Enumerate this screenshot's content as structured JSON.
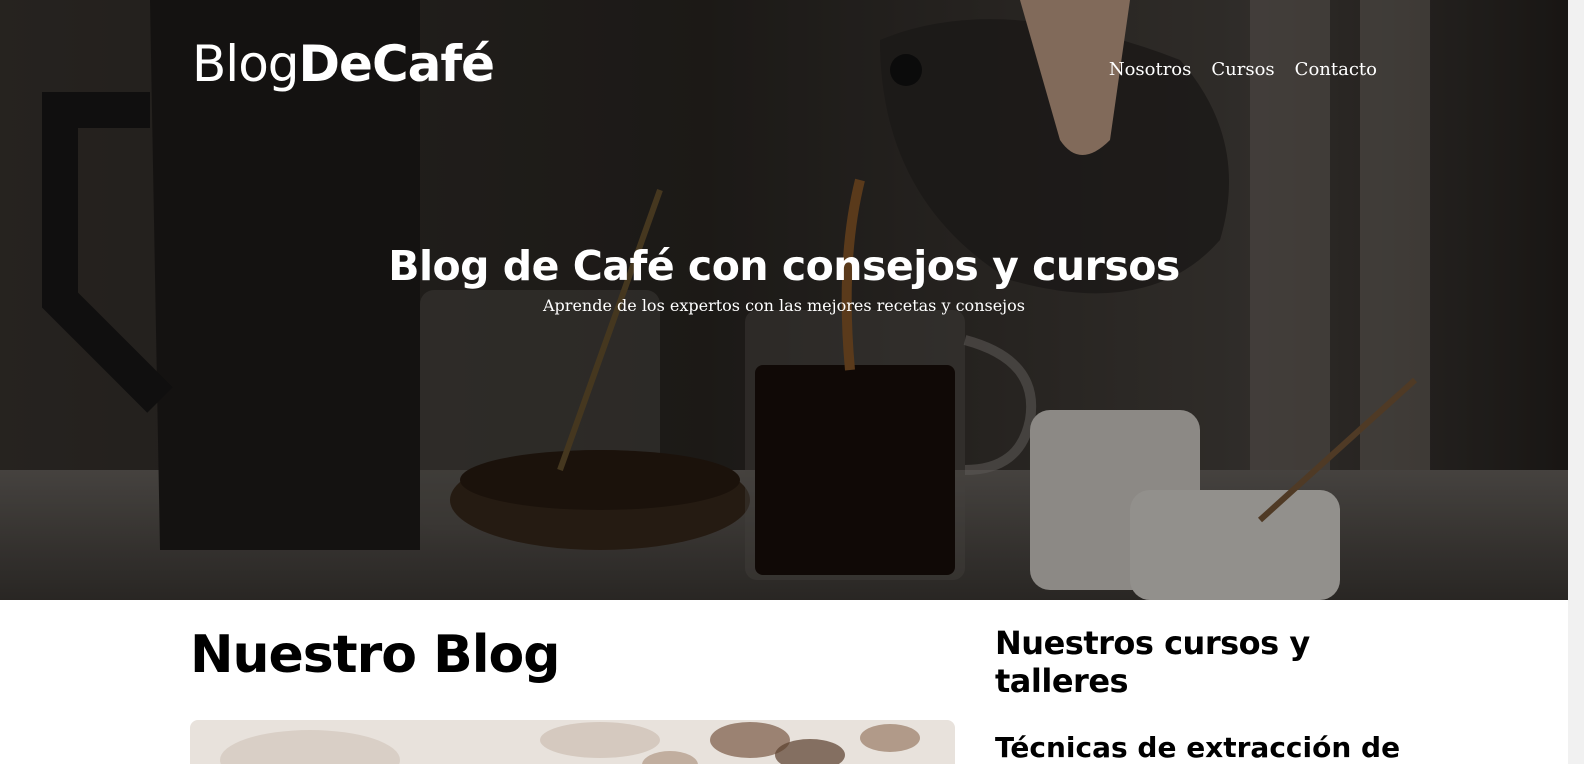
{
  "header": {
    "logo_part1": "Blog",
    "logo_part2": "DeCafé",
    "nav": [
      "Nosotros",
      "Cursos",
      "Contacto"
    ]
  },
  "hero": {
    "title": "Blog de Café con consejos y cursos",
    "subtitle": "Aprende de los expertos con las mejores recetas y consejos"
  },
  "main": {
    "blog_title": "Nuestro Blog",
    "courses_title": "Nuestros cursos y talleres",
    "course_item_title": "Técnicas de extracción de"
  }
}
